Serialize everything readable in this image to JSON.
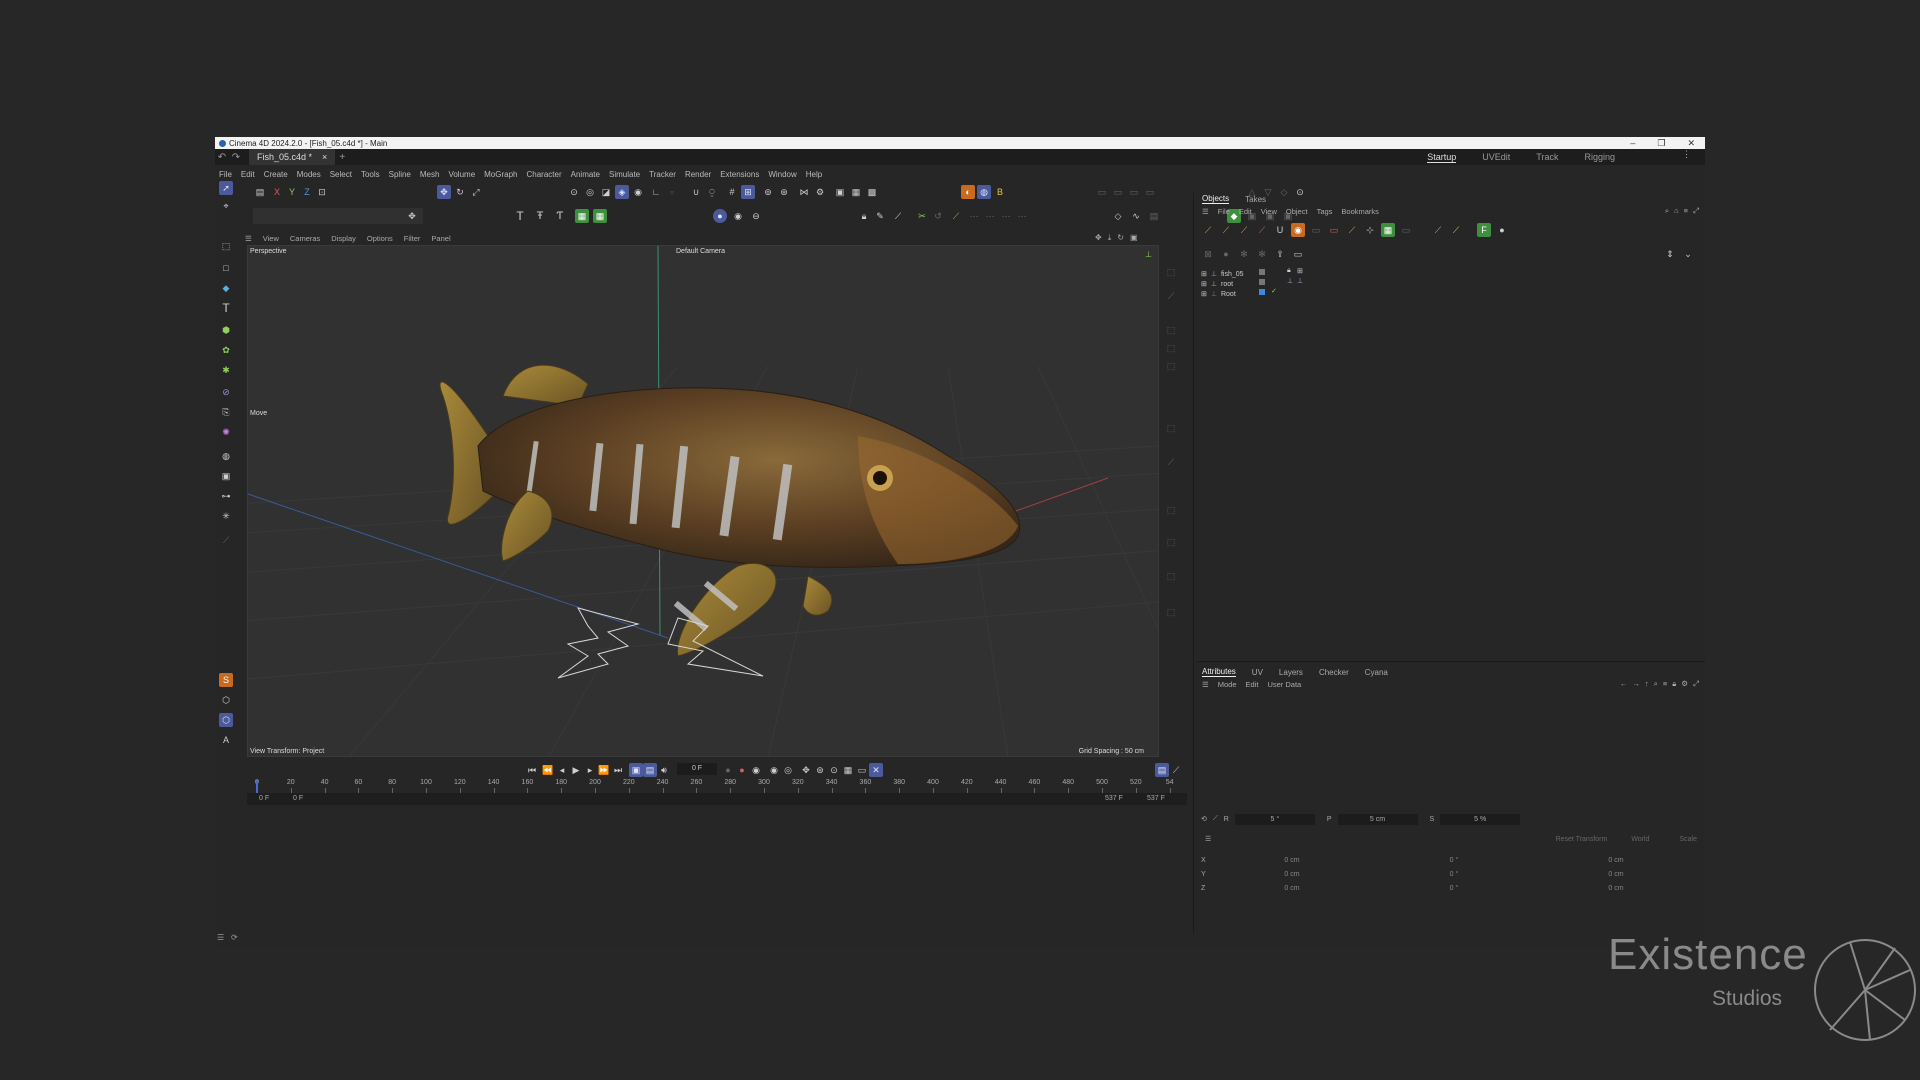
{
  "window": {
    "title": "Cinema 4D 2024.2.0 - [Fish_05.c4d *] - Main"
  },
  "tabs": {
    "doc_tab": "Fish_05.c4d *",
    "close": "×",
    "add": "+",
    "layouts": [
      "Startup",
      "UVEdit",
      "Track",
      "Rigging"
    ],
    "active_layout": "Startup"
  },
  "menu": [
    "File",
    "Edit",
    "Create",
    "Modes",
    "Select",
    "Tools",
    "Spline",
    "Mesh",
    "Volume",
    "MoGraph",
    "Character",
    "Animate",
    "Simulate",
    "Tracker",
    "Render",
    "Extensions",
    "Window",
    "Help"
  ],
  "axis_buttons": [
    "X",
    "Y",
    "Z"
  ],
  "viewport": {
    "menu": [
      "View",
      "Cameras",
      "Display",
      "Options",
      "Filter",
      "Panel"
    ],
    "name": "Perspective",
    "camera": "Default Camera",
    "tool": "Move",
    "view_transform": "View Transform: Project",
    "grid_spacing": "Grid Spacing : 50 cm"
  },
  "timeline": {
    "current_frame": "0 F",
    "start": "0 F",
    "start2": "0 F",
    "end": "537 F",
    "end2": "537 F",
    "ticks": [
      "0",
      "20",
      "40",
      "60",
      "80",
      "100",
      "120",
      "140",
      "160",
      "180",
      "200",
      "220",
      "240",
      "260",
      "280",
      "300",
      "320",
      "340",
      "360",
      "380",
      "400",
      "420",
      "440",
      "460",
      "480",
      "500",
      "520",
      "54"
    ]
  },
  "objects_panel": {
    "tabs": [
      "Objects",
      "Takes"
    ],
    "active_tab": "Objects",
    "menu": [
      "File",
      "Edit",
      "View",
      "Object",
      "Tags",
      "Bookmarks"
    ],
    "items": [
      {
        "name": "fish_05"
      },
      {
        "name": "root"
      },
      {
        "name": "Root"
      }
    ]
  },
  "attributes_panel": {
    "tabs": [
      "Attributes",
      "UV",
      "Layers",
      "Checker",
      "Cyana"
    ],
    "active_tab": "Attributes",
    "menu": [
      "Mode",
      "Edit",
      "User Data"
    ]
  },
  "coordinates": {
    "r_label": "R",
    "r_value": "5 °",
    "p_label": "P",
    "p_value": "5 cm",
    "s_label": "S",
    "s_value": "5 %",
    "reset": "Reset Transform",
    "space": "World",
    "mode": "Scale",
    "rows": [
      {
        "axis": "X",
        "pos": "0 cm",
        "rot": "0 °",
        "size": "0 cm"
      },
      {
        "axis": "Y",
        "pos": "0 cm",
        "rot": "0 °",
        "size": "0 cm"
      },
      {
        "axis": "Z",
        "pos": "0 cm",
        "rot": "0 °",
        "size": "0 cm"
      }
    ]
  },
  "watermark": {
    "title": "Existence",
    "subtitle": "Studios"
  },
  "colors": {
    "accent": "#4a5a9a",
    "viewport_bg": "#313131",
    "fish_body": "#6b4a26"
  }
}
